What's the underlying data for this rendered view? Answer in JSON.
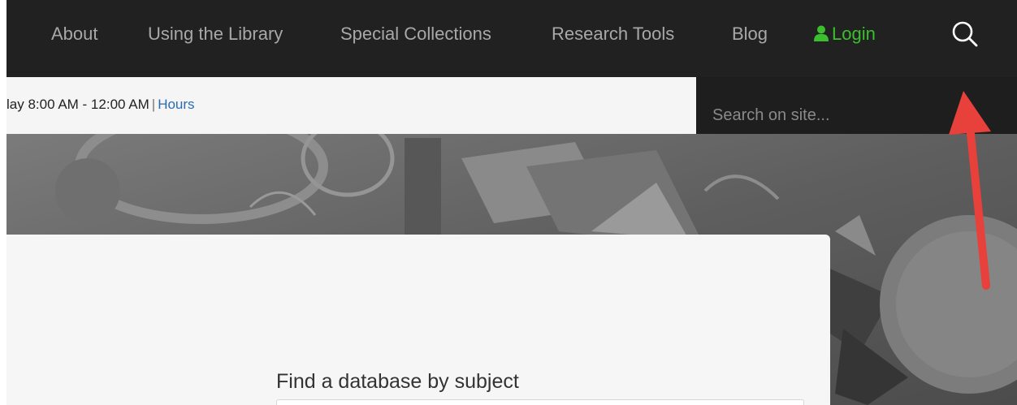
{
  "nav": {
    "items": [
      {
        "label": "About"
      },
      {
        "label": "Using the Library"
      },
      {
        "label": "Special Collections"
      },
      {
        "label": "Research Tools"
      },
      {
        "label": "Blog"
      }
    ],
    "login_label": "Login",
    "login_icon": "user-icon",
    "search_icon": "search-icon"
  },
  "hours": {
    "text": "lay 8:00 AM - 12:00 AM",
    "separator": "|",
    "link_label": "Hours"
  },
  "search": {
    "placeholder": "Search on site..."
  },
  "card": {
    "heading": "Find a database by subject"
  },
  "colors": {
    "nav_background": "#212121",
    "nav_text": "#a8a8a8",
    "login_accent": "#3bbf2e",
    "link": "#2b6cb0",
    "annotation_arrow": "#e8403a"
  }
}
